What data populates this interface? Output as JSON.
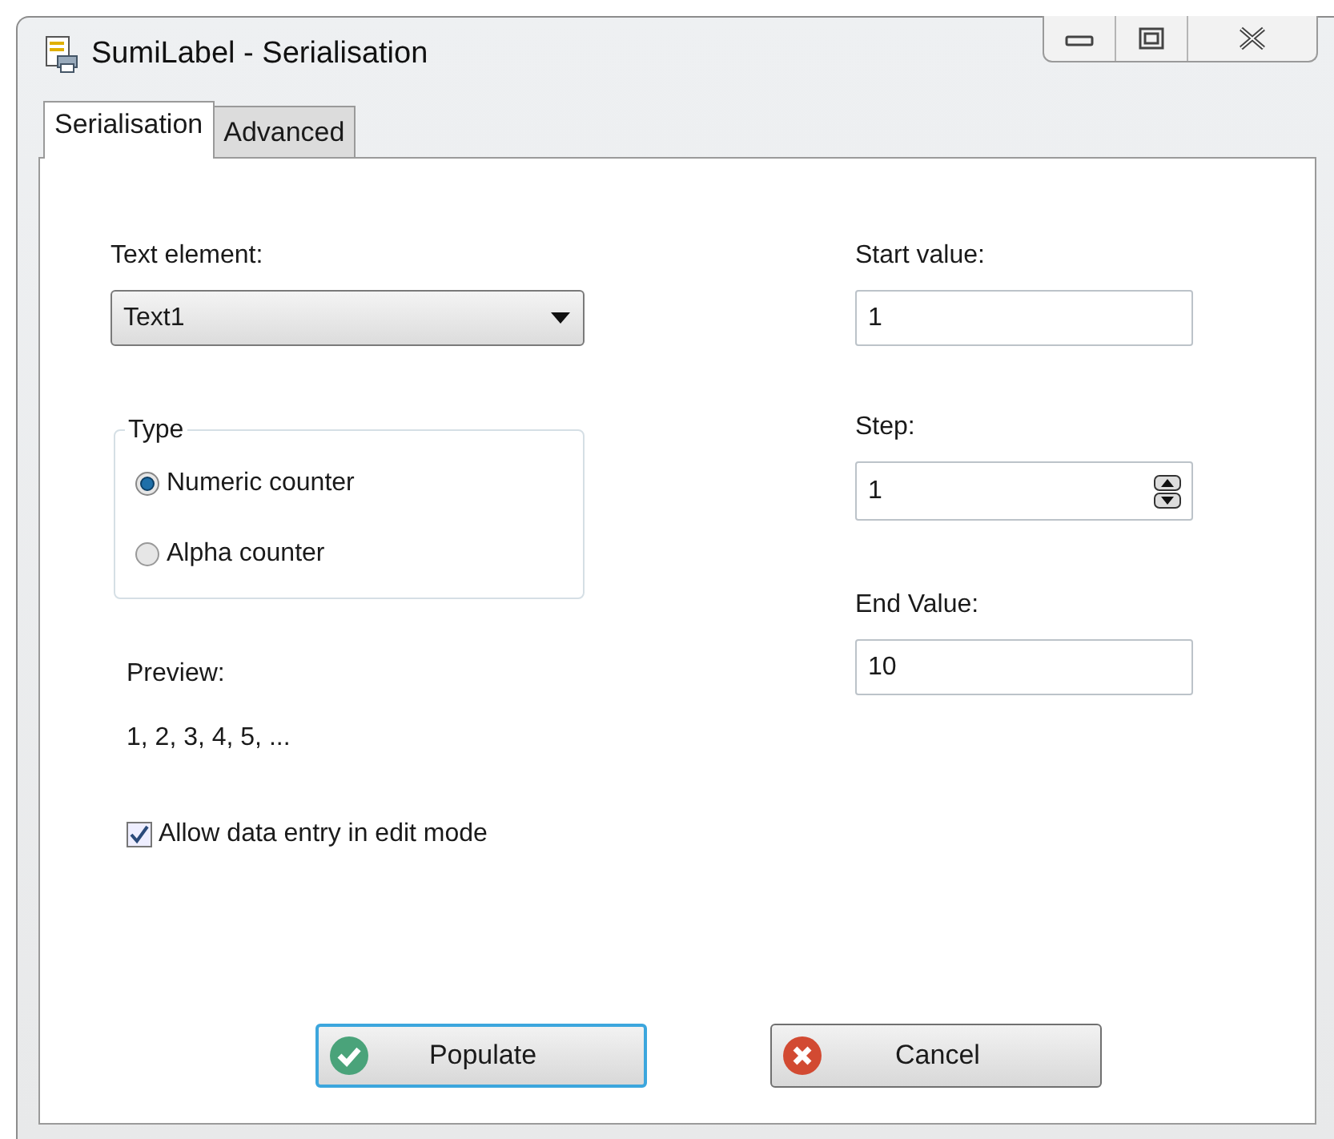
{
  "window": {
    "title": "SumiLabel - Serialisation"
  },
  "tabs": [
    {
      "label": "Serialisation",
      "selected": true
    },
    {
      "label": "Advanced",
      "selected": false
    }
  ],
  "text_element": {
    "label": "Text element:",
    "value": "Text1"
  },
  "type_group": {
    "title": "Type",
    "options": [
      {
        "label": "Numeric counter",
        "selected": true
      },
      {
        "label": "Alpha counter",
        "selected": false
      }
    ]
  },
  "preview": {
    "label": "Preview:",
    "value": "1, 2, 3, 4, 5, ..."
  },
  "allow_edit": {
    "label": "Allow data entry in edit mode",
    "checked": true
  },
  "fields": [
    {
      "kind": "text",
      "label": "Start value:",
      "value": "1"
    },
    {
      "kind": "spin",
      "label": "Step:",
      "value": "1"
    },
    {
      "kind": "text",
      "label": "End Value:",
      "value": "10"
    }
  ],
  "buttons": [
    {
      "kind": "confirm",
      "label": "Populate",
      "focused": true
    },
    {
      "kind": "cancel",
      "label": "Cancel",
      "focused": false
    }
  ]
}
